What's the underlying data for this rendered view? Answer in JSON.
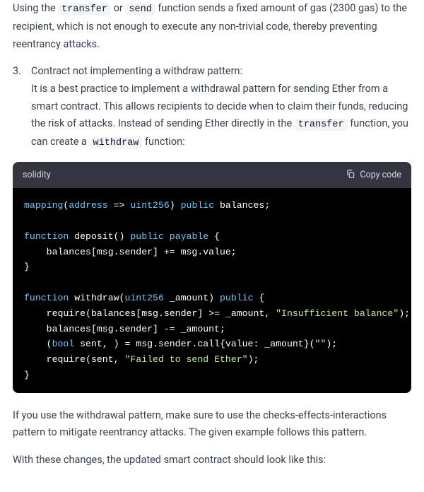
{
  "para1": {
    "pre": "Using the ",
    "code1": "transfer",
    "mid1": " or ",
    "code2": "send",
    "post": " function sends a fixed amount of gas (2300 gas) to the recipient, which is not enough to execute any non-trivial code, thereby preventing reentrancy attacks."
  },
  "list": {
    "item": {
      "title": "Contract not implementing a withdraw pattern:",
      "body_pre": "It is a best practice to implement a withdrawal pattern for sending Ether from a smart contract. This allows recipients to decide when to claim their funds, reducing the risk of attacks. Instead of sending Ether directly in the ",
      "code1": "transfer",
      "body_mid": " function, you can create a ",
      "code2": "withdraw",
      "body_post": " function:"
    }
  },
  "codeblock": {
    "lang": "solidity",
    "copy_label": "Copy code",
    "lines": {
      "l1": {
        "a": "mapping",
        "b": "(",
        "c": "address",
        "d": " => ",
        "e": "uint256",
        "f": ") ",
        "g": "public",
        "h": " balances;"
      },
      "l2": "",
      "l3": {
        "a": "function",
        "b": " ",
        "c": "deposit",
        "d": "() ",
        "e": "public",
        "f": " ",
        "g": "payable",
        "h": " {"
      },
      "l4": {
        "a": "    balances[msg.sender] += msg.value;"
      },
      "l5": {
        "a": "}"
      },
      "l6": "",
      "l7": {
        "a": "function",
        "b": " ",
        "c": "withdraw",
        "d": "(",
        "e": "uint256",
        "f": " _amount) ",
        "g": "public",
        "h": " {"
      },
      "l8": {
        "a": "    ",
        "b": "require",
        "c": "(balances[msg.sender] >= _amount, ",
        "d": "\"Insufficient balance\"",
        "e": ");"
      },
      "l9": {
        "a": "    balances[msg.sender] -= _amount;"
      },
      "l10": {
        "a": "    (",
        "b": "bool",
        "c": " sent, ) = msg.sender.call{value: _amount}(",
        "d": "\"\"",
        "e": ");"
      },
      "l11": {
        "a": "    ",
        "b": "require",
        "c": "(sent, ",
        "d": "\"Failed to send Ether\"",
        "e": ");"
      },
      "l12": {
        "a": "}"
      }
    }
  },
  "para2": "If you use the withdrawal pattern, make sure to use the checks-effects-interactions pattern to mitigate reentrancy attacks. The given example follows this pattern.",
  "para3": "With these changes, the updated smart contract should look like this:"
}
